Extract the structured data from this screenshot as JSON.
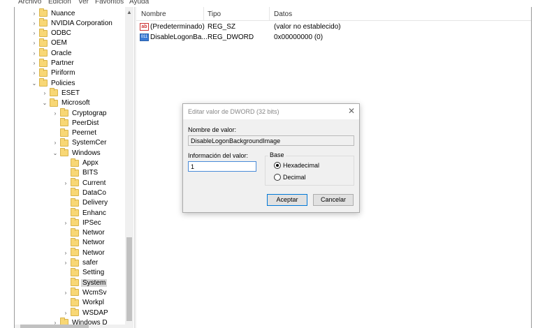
{
  "menu": {
    "items": [
      "Archivo",
      "Edición",
      "Ver",
      "Favoritos",
      "Ayuda"
    ]
  },
  "tree": {
    "items": [
      {
        "label": "Nuance",
        "expand": ">"
      },
      {
        "label": "NVIDIA Corporation",
        "expand": ">"
      },
      {
        "label": "ODBC",
        "expand": ">"
      },
      {
        "label": "OEM",
        "expand": ">"
      },
      {
        "label": "Oracle",
        "expand": ">"
      },
      {
        "label": "Partner",
        "expand": ">"
      },
      {
        "label": "Piriform",
        "expand": ">"
      },
      {
        "label": "Policies",
        "expand": "v"
      },
      {
        "label": "ESET",
        "expand": ">"
      },
      {
        "label": "Microsoft",
        "expand": "v"
      },
      {
        "label": "Cryptograp",
        "expand": ">"
      },
      {
        "label": "PeerDist",
        "expand": ""
      },
      {
        "label": "Peernet",
        "expand": ""
      },
      {
        "label": "SystemCer",
        "expand": ">"
      },
      {
        "label": "Windows",
        "expand": "v"
      },
      {
        "label": "Appx",
        "expand": ""
      },
      {
        "label": "BITS",
        "expand": ""
      },
      {
        "label": "Current",
        "expand": ">"
      },
      {
        "label": "DataCo",
        "expand": ""
      },
      {
        "label": "Delivery",
        "expand": ""
      },
      {
        "label": "Enhanc",
        "expand": ""
      },
      {
        "label": "IPSec",
        "expand": ">"
      },
      {
        "label": "Networ",
        "expand": ""
      },
      {
        "label": "Networ",
        "expand": ""
      },
      {
        "label": "Networ",
        "expand": ">"
      },
      {
        "label": "safer",
        "expand": ">"
      },
      {
        "label": "Setting",
        "expand": ""
      },
      {
        "label": "System",
        "expand": ""
      },
      {
        "label": "WcmSv",
        "expand": ">"
      },
      {
        "label": "Workpl",
        "expand": ""
      },
      {
        "label": "WSDAP",
        "expand": ">"
      },
      {
        "label": "Windows D",
        "expand": ">"
      }
    ],
    "selected_label": "System"
  },
  "list": {
    "columns": [
      "Nombre",
      "Tipo",
      "Datos"
    ],
    "rows": [
      {
        "icon": "string-value-icon",
        "icon_text": "ab",
        "name": "(Predeterminado)",
        "type": "REG_SZ",
        "data": "(valor no establecido)"
      },
      {
        "icon": "binary-value-icon",
        "icon_text": "011",
        "name": "DisableLogonBa...",
        "type": "REG_DWORD",
        "data": "0x00000000 (0)"
      }
    ]
  },
  "dialog": {
    "title": "Editar valor de DWORD (32 bits)",
    "close_glyph": "✕",
    "value_name_label": "Nombre de valor:",
    "value_name": "DisableLogonBackgroundImage",
    "value_data_label": "Información del valor:",
    "value_data": "1",
    "base_label": "Base",
    "base_options": [
      "Hexadecimal",
      "Decimal"
    ],
    "base_selected": "Hexadecimal",
    "ok_label": "Aceptar",
    "cancel_label": "Cancelar"
  }
}
